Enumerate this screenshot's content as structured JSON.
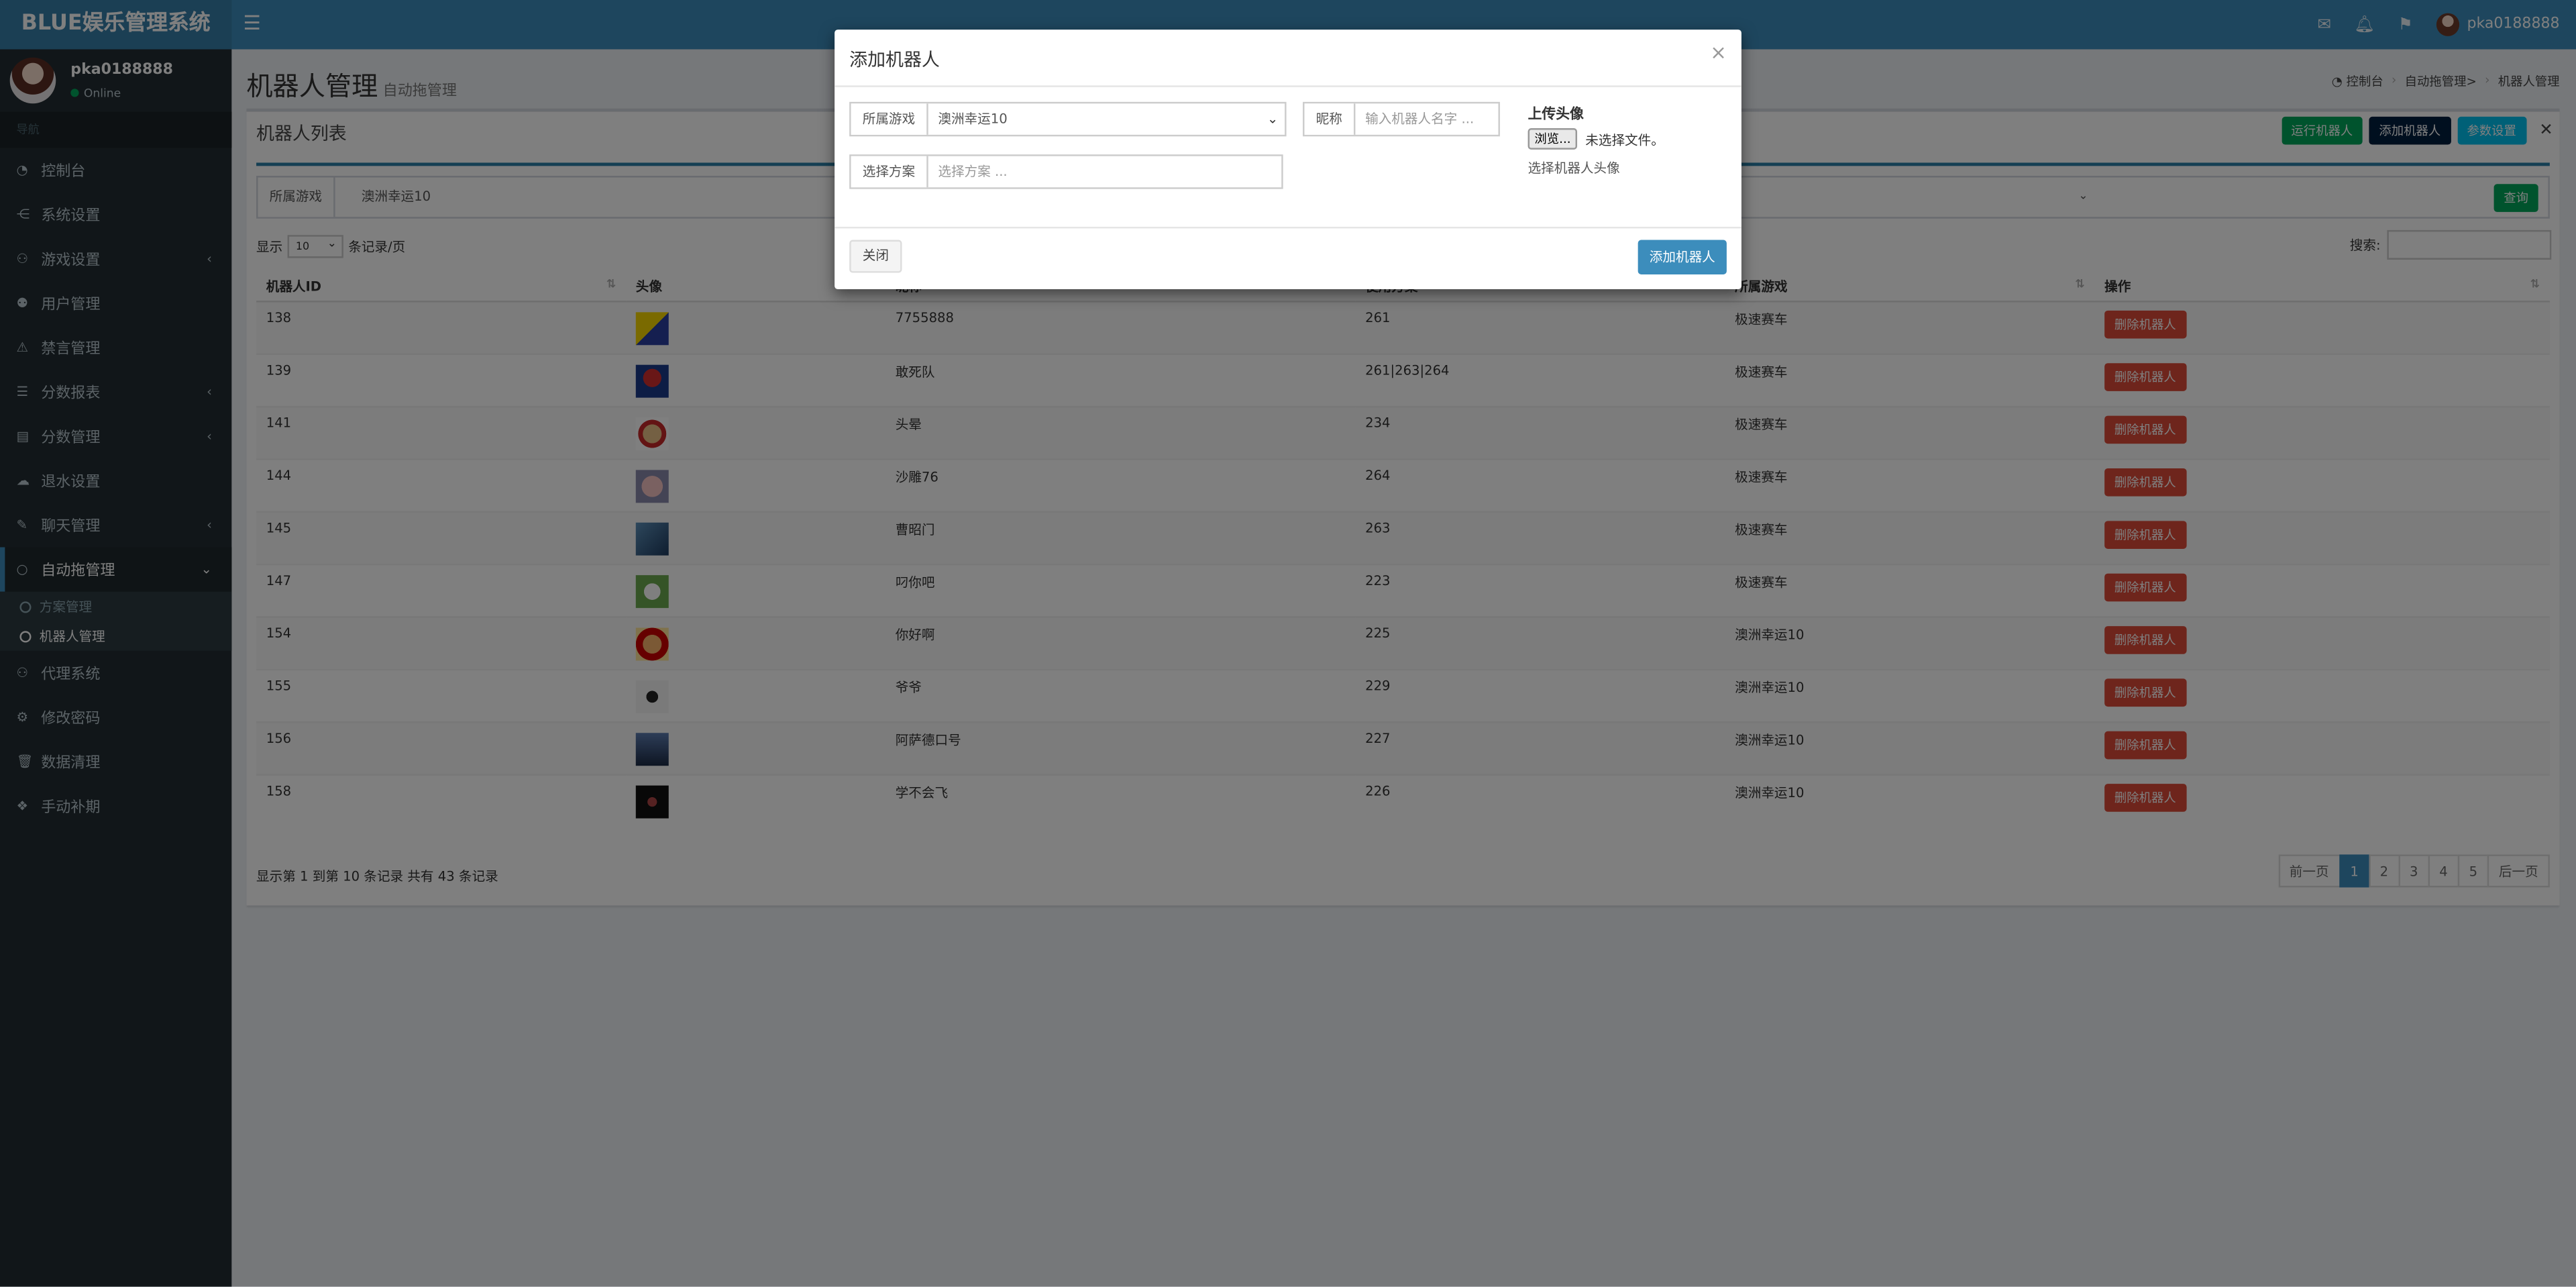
{
  "app": {
    "title": "BLUE娱乐管理系统"
  },
  "topbar": {
    "user_name": "pka0188888",
    "icons": [
      "envelope-icon",
      "bell-icon",
      "flag-icon"
    ]
  },
  "sidebar": {
    "user": {
      "name": "pka0188888",
      "status": "Online"
    },
    "nav_header": "导航",
    "items": [
      {
        "label": "控制台",
        "icon": "dashboard-icon",
        "chevron": false
      },
      {
        "label": "系统设置",
        "icon": "share-icon",
        "chevron": false
      },
      {
        "label": "游戏设置",
        "icon": "gamepad-icon",
        "chevron": true
      },
      {
        "label": "用户管理",
        "icon": "users-icon",
        "chevron": false
      },
      {
        "label": "禁言管理",
        "icon": "warning-icon",
        "chevron": false
      },
      {
        "label": "分数报表",
        "icon": "list-icon",
        "chevron": true
      },
      {
        "label": "分数管理",
        "icon": "file-icon",
        "chevron": true
      },
      {
        "label": "退水设置",
        "icon": "cloud-icon",
        "chevron": false
      },
      {
        "label": "聊天管理",
        "icon": "comments-icon",
        "chevron": true
      },
      {
        "label": "自动拖管理",
        "icon": "comment-icon",
        "chevron": true
      }
    ],
    "subitems": [
      {
        "label": "方案管理"
      },
      {
        "label": "机器人管理"
      }
    ],
    "items_after": [
      {
        "label": "代理系统",
        "icon": "user-plus-icon"
      },
      {
        "label": "修改密码",
        "icon": "gear-icon"
      },
      {
        "label": "数据清理",
        "icon": "trash-icon"
      },
      {
        "label": "手动补期",
        "icon": "cubes-icon"
      }
    ]
  },
  "page": {
    "title": "机器人管理",
    "subtitle": "自动拖管理",
    "breadcrumb": [
      "控制台",
      "自动拖管理>",
      "机器人管理"
    ]
  },
  "box": {
    "title": "机器人列表",
    "tools": {
      "run": "运行机器人",
      "add": "添加机器人",
      "params": "参数设置"
    },
    "filter": {
      "label": "所属游戏",
      "value": "澳洲幸运10",
      "query": "查询"
    },
    "length": {
      "prefix": "显示",
      "value": "10",
      "suffix": "条记录/页"
    },
    "search_label": "搜索:",
    "columns": [
      "机器人ID",
      "头像",
      "昵称",
      "使用方案",
      "所属游戏",
      "操作"
    ],
    "rows": [
      {
        "id": "138",
        "nick": "7755888",
        "plan": "261",
        "game": "极速赛车",
        "action": "删除机器人"
      },
      {
        "id": "139",
        "nick": "敢死队",
        "plan": "261|263|264",
        "game": "极速赛车",
        "action": "删除机器人"
      },
      {
        "id": "141",
        "nick": "头晕",
        "plan": "234",
        "game": "极速赛车",
        "action": "删除机器人"
      },
      {
        "id": "144",
        "nick": "沙雕76",
        "plan": "264",
        "game": "极速赛车",
        "action": "删除机器人"
      },
      {
        "id": "145",
        "nick": "曹昭门",
        "plan": "263",
        "game": "极速赛车",
        "action": "删除机器人"
      },
      {
        "id": "147",
        "nick": "叼你吧",
        "plan": "223",
        "game": "极速赛车",
        "action": "删除机器人"
      },
      {
        "id": "154",
        "nick": "你好啊",
        "plan": "225",
        "game": "澳洲幸运10",
        "action": "删除机器人"
      },
      {
        "id": "155",
        "nick": "爷爷",
        "plan": "229",
        "game": "澳洲幸运10",
        "action": "删除机器人"
      },
      {
        "id": "156",
        "nick": "阿萨德口号",
        "plan": "227",
        "game": "澳洲幸运10",
        "action": "删除机器人"
      },
      {
        "id": "158",
        "nick": "学不会飞",
        "plan": "226",
        "game": "澳洲幸运10",
        "action": "删除机器人"
      }
    ],
    "info": "显示第 1 到第 10 条记录 共有 43 条记录",
    "pager": {
      "prev": "前一页",
      "pages": [
        "1",
        "2",
        "3",
        "4",
        "5"
      ],
      "next": "后一页",
      "current": "1"
    }
  },
  "modal": {
    "title": "添加机器人",
    "game_label": "所属游戏",
    "game_value": "澳洲幸运10",
    "nick_label": "昵称",
    "nick_placeholder": "输入机器人名字 ...",
    "plan_label": "选择方案",
    "plan_placeholder": "选择方案 ...",
    "upload_title": "上传头像",
    "browse_label": "浏览...",
    "no_file": "未选择文件。",
    "upload_help": "选择机器人头像",
    "close_label": "关闭",
    "submit_label": "添加机器人"
  }
}
